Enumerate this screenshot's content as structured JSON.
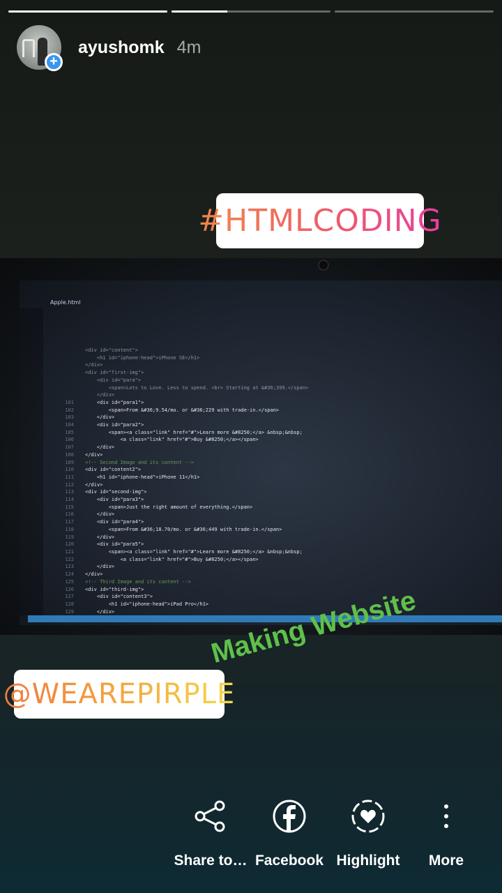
{
  "story": {
    "progress": [
      1.0,
      0.35,
      0.0
    ],
    "username": "ayushomk",
    "time": "4m",
    "avatar_badge_icon": "plus-icon"
  },
  "stickers": {
    "hashtag": "#HTMLCODING",
    "mention": "@WEAREPIRPLE",
    "text_overlay": "Making Website"
  },
  "editor": {
    "tab": "Apple.html",
    "lines": [
      {
        "n": "",
        "t": "<div id=\"content\">"
      },
      {
        "n": "",
        "t": "    <h1 id=\"iphone-head\">iPhone SE</h1>"
      },
      {
        "n": "",
        "t": "</div>"
      },
      {
        "n": "",
        "t": "<div id=\"first-img\">"
      },
      {
        "n": "",
        "t": "    <div id=\"para\">"
      },
      {
        "n": "",
        "t": "        <span>Lots to Love. Less to spend. <br> Starting at &#36;399.</span>"
      },
      {
        "n": "",
        "t": "    </div>"
      },
      {
        "n": "101",
        "t": "    <div id=\"para1\">"
      },
      {
        "n": "102",
        "t": "        <span>From &#36;9.54/mo. or &#36;229 with trade-in.</span>"
      },
      {
        "n": "103",
        "t": "    </div>"
      },
      {
        "n": "104",
        "t": "    <div id=\"para2\">"
      },
      {
        "n": "105",
        "t": "        <span><a class=\"link\" href=\"#\">Learn more &#8250;</a> &nbsp;&nbsp;"
      },
      {
        "n": "106",
        "t": "            <a class=\"link\" href=\"#\">Buy &#8250;</a></span>"
      },
      {
        "n": "107",
        "t": "    </div>"
      },
      {
        "n": "108",
        "t": "</div>"
      },
      {
        "n": "109",
        "t": "<!-- Second Image and its content -->"
      },
      {
        "n": "110",
        "t": "<div id=\"content2\">"
      },
      {
        "n": "111",
        "t": "    <h1 id=\"iphone-head\">iPhone 11</h1>"
      },
      {
        "n": "112",
        "t": "</div>"
      },
      {
        "n": "113",
        "t": "<div id=\"second-img\">"
      },
      {
        "n": "114",
        "t": "    <div id=\"para3\">"
      },
      {
        "n": "115",
        "t": "        <span>Just the right amount of everything.</span>"
      },
      {
        "n": "116",
        "t": "    </div>"
      },
      {
        "n": "117",
        "t": "    <div id=\"para4\">"
      },
      {
        "n": "118",
        "t": "        <span>From &#36;18.70/mo. or &#36;449 with trade-in.</span>"
      },
      {
        "n": "119",
        "t": "    </div>"
      },
      {
        "n": "120",
        "t": "    <div id=\"para5\">"
      },
      {
        "n": "121",
        "t": "        <span><a class=\"link\" href=\"#\">Learn more &#8250;</a> &nbsp;&nbsp;"
      },
      {
        "n": "122",
        "t": "            <a class=\"link\" href=\"#\">Buy &#8250;</a></span>"
      },
      {
        "n": "123",
        "t": "    </div>"
      },
      {
        "n": "124",
        "t": "</div>"
      },
      {
        "n": "125",
        "t": "<!-- Third Image and its content -->"
      },
      {
        "n": "126",
        "t": "<div id=\"third-img\">"
      },
      {
        "n": "127",
        "t": "    <div id=\"content3\">"
      },
      {
        "n": "128",
        "t": "        <h1 id=\"iphone-head\">iPad Pro</h1>"
      },
      {
        "n": "129",
        "t": "    </div>"
      }
    ]
  },
  "actions": [
    {
      "label": "Share to…",
      "icon": "share-icon"
    },
    {
      "label": "Facebook",
      "icon": "facebook-icon"
    },
    {
      "label": "Highlight",
      "icon": "highlight-heart-icon"
    },
    {
      "label": "More",
      "icon": "more-vertical-icon"
    }
  ],
  "colors": {
    "hashtag_gradient": [
      "#f0874a",
      "#e93fa0"
    ],
    "mention_gradient": [
      "#f07a3e",
      "#f4d94a"
    ],
    "making_website": "#5fc04a",
    "badge": "#3897f0"
  }
}
